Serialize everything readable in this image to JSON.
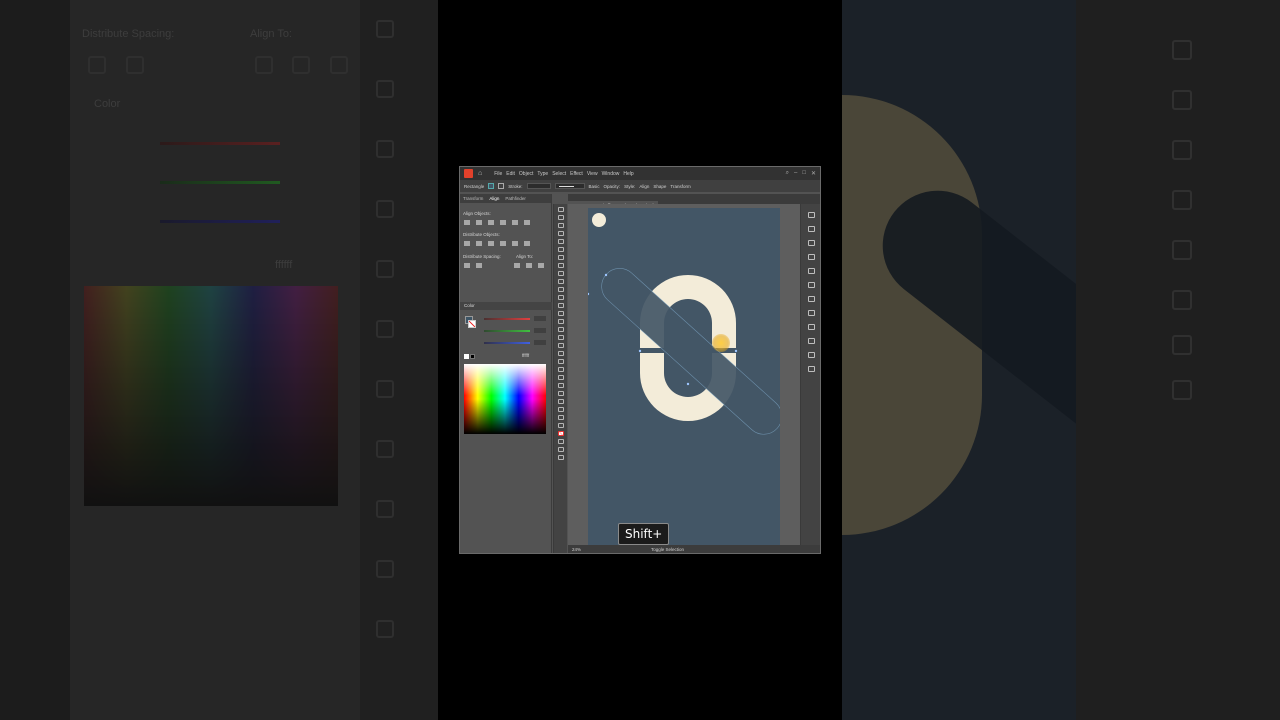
{
  "menu": {
    "items": [
      "File",
      "Edit",
      "Object",
      "Type",
      "Select",
      "Effect",
      "View",
      "Window",
      "Help"
    ]
  },
  "control_bar": {
    "tool": "Rectangle",
    "stroke_label": "Stroke:",
    "stroke_style": "Basic",
    "opacity_label": "Opacity:",
    "style_label": "Style:",
    "align_label": "Align",
    "shape_label": "Shape",
    "transform_label": "Transform"
  },
  "panels": {
    "tabs": [
      "Transform",
      "Align",
      "Pathfinder"
    ],
    "align_objects": "Align Objects:",
    "distribute_objects": "Distribute Objects:",
    "distribute_spacing": "Distribute Spacing:",
    "align_to": "Align To:",
    "color_title": "Color",
    "hex_value": "ffffff"
  },
  "document": {
    "tab_title": "Letter S Logo.ai* @ 24 % (RGB/Preview)"
  },
  "status": {
    "zoom": "24%",
    "tool_name": "Toggle Selection"
  },
  "overlay": {
    "keystroke": "Shift+"
  },
  "colors": {
    "artboard": "#435666",
    "letter": "#f3ecd9",
    "accent_cursor": "#f5c542"
  },
  "background": {
    "left_label_1": "Distribute Spacing:",
    "left_label_2": "Align To:",
    "left_color_title": "Color",
    "left_hex": "ffffff"
  }
}
